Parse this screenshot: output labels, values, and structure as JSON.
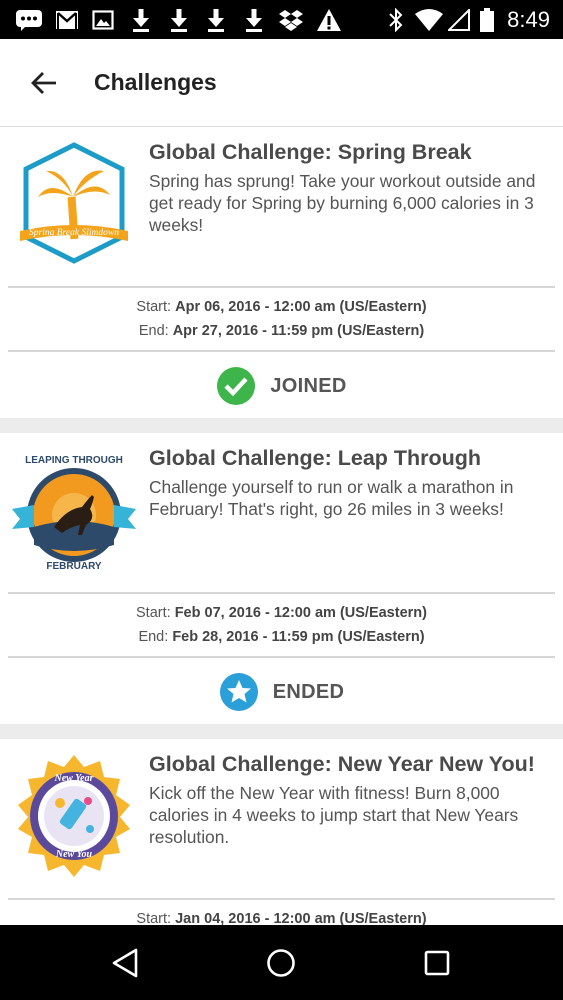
{
  "status_bar": {
    "time": "8:49",
    "left_icons": [
      "chat-icon",
      "gmail-icon",
      "image-icon",
      "download-icon",
      "download-icon",
      "download-icon",
      "download-icon",
      "dropbox-icon",
      "warning-icon"
    ],
    "right_icons": [
      "bluetooth-icon",
      "wifi-icon",
      "signal-icon",
      "battery-icon"
    ]
  },
  "app_bar": {
    "title": "Challenges",
    "back_icon": "arrow-back-icon"
  },
  "challenges": [
    {
      "title": "Global Challenge: Spring Break",
      "description": "Spring has sprung! Take your workout outside and get ready for Spring by burning 6,000 calories in 3 weeks!",
      "badge_text": "Spring Break Slimdown",
      "start_label": "Start:",
      "start_value": "Apr 06, 2016 - 12:00 am (US/Eastern)",
      "end_label": "End:",
      "end_value": "Apr 27, 2016 - 11:59 pm (US/Eastern)",
      "status": "JOINED",
      "status_icon": "check-circle-icon",
      "status_color": "#3db54a"
    },
    {
      "title": "Global Challenge: Leap Through",
      "description": "Challenge yourself to run or walk a marathon in February! That's right, go 26 miles in 3 weeks!",
      "badge_text_top": "LEAPING THROUGH",
      "badge_text_bottom": "FEBRUARY",
      "start_label": "Start:",
      "start_value": "Feb 07, 2016 - 12:00 am (US/Eastern)",
      "end_label": "End:",
      "end_value": "Feb 28, 2016 - 11:59 pm (US/Eastern)",
      "status": "ENDED",
      "status_icon": "star-circle-icon",
      "status_color": "#2a9fd8"
    },
    {
      "title": "Global Challenge: New Year New You!",
      "description": "Kick off the New Year with fitness! Burn 8,000 calories in 4 weeks to jump start that New Years resolution.",
      "badge_text_top": "New Year",
      "badge_text_bottom": "New You",
      "start_label": "Start:",
      "start_value": "Jan 04, 2016 - 12:00 am (US/Eastern)"
    }
  ],
  "nav_bar": {
    "icons": [
      "back-triangle-icon",
      "home-circle-icon",
      "recents-square-icon"
    ]
  },
  "colors": {
    "accent_green": "#3db54a",
    "accent_blue": "#2a9fd8",
    "text_dark": "#4a4a4a",
    "divider": "#d6d6d6"
  }
}
